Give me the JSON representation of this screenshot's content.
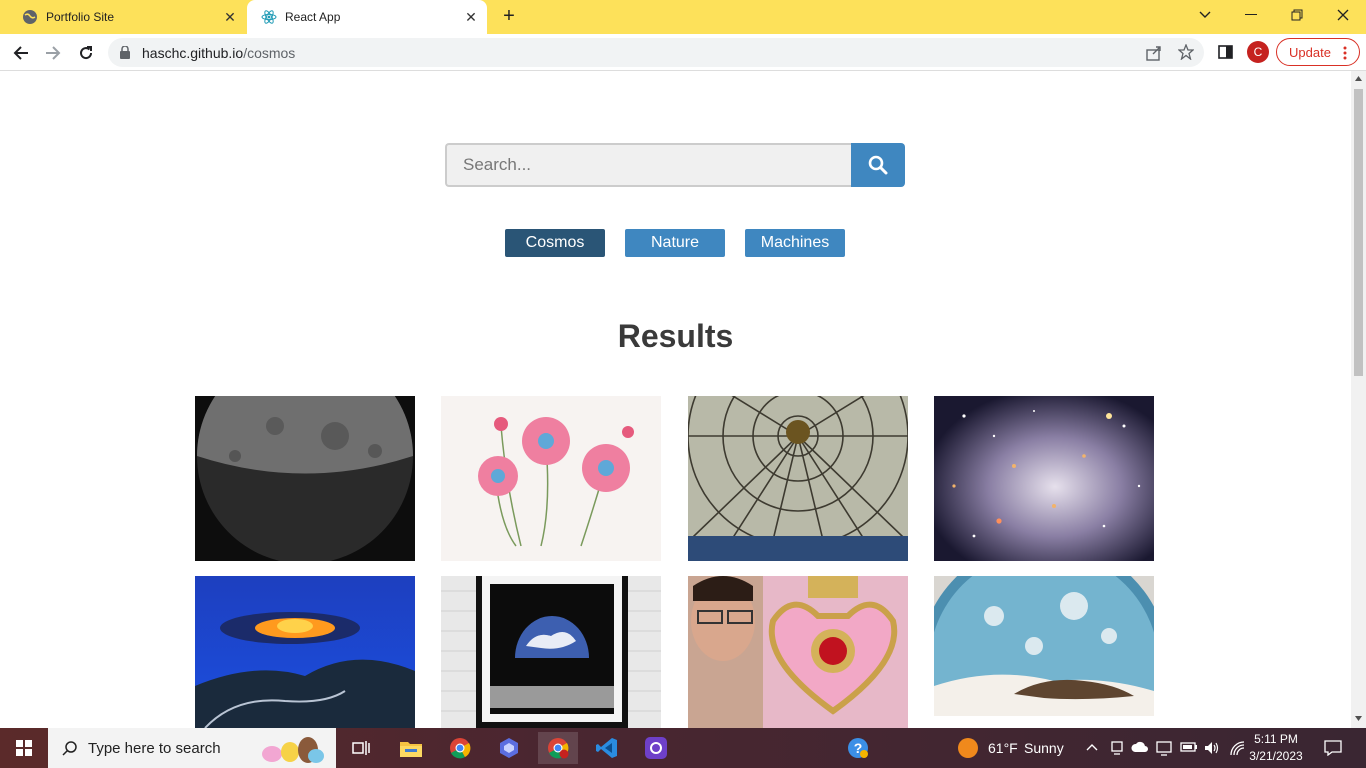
{
  "browser": {
    "tabs": [
      {
        "title": "Portfolio Site",
        "active": false
      },
      {
        "title": "React App",
        "active": true
      }
    ],
    "new_tab_symbol": "+",
    "close_symbol": "✕",
    "url_host": "haschc.github.io",
    "url_path": "/cosmos",
    "avatar_letter": "C",
    "update_label": "Update",
    "accent_color": "#fde15a"
  },
  "page": {
    "search_placeholder": "Search...",
    "categories": [
      {
        "label": "Cosmos",
        "selected": true
      },
      {
        "label": "Nature",
        "selected": false
      },
      {
        "label": "Machines",
        "selected": false
      }
    ],
    "results_heading": "Results",
    "button_color": "#3f87c0",
    "selected_button_color": "#2a5576",
    "gallery": [
      {
        "name": "gallery-image-moon"
      },
      {
        "name": "gallery-image-cosmos-flowers"
      },
      {
        "name": "gallery-image-glass-dome"
      },
      {
        "name": "gallery-image-star-cluster"
      },
      {
        "name": "gallery-image-sunset-hills"
      },
      {
        "name": "gallery-image-earthrise-art"
      },
      {
        "name": "gallery-image-person-with-compact"
      },
      {
        "name": "gallery-image-planet-clouds"
      }
    ]
  },
  "taskbar": {
    "search_placeholder": "Type here to search",
    "weather_temp": "61°F",
    "weather_condition": "Sunny",
    "time": "5:11 PM",
    "date": "3/21/2023"
  }
}
